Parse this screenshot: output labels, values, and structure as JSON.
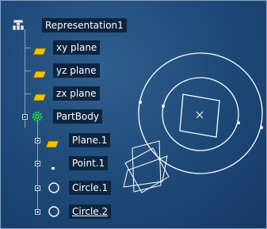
{
  "tree": {
    "root": {
      "label": "Representation1",
      "icon": "representation-icon"
    },
    "items": [
      {
        "label": "xy plane",
        "icon": "plane-icon",
        "expandable": false,
        "underline": false
      },
      {
        "label": "yz plane",
        "icon": "plane-icon",
        "expandable": false,
        "underline": false
      },
      {
        "label": "zx plane",
        "icon": "plane-icon",
        "expandable": false,
        "underline": false
      },
      {
        "label": "PartBody",
        "icon": "gear-icon",
        "expandable": true,
        "expander": "minus",
        "underline": false
      },
      {
        "label": "Plane.1",
        "icon": "plane-icon",
        "expandable": true,
        "expander": "plus",
        "underline": false
      },
      {
        "label": "Point.1",
        "icon": "point-icon",
        "expandable": true,
        "expander": "plus",
        "underline": false
      },
      {
        "label": "Circle.1",
        "icon": "circle-icon",
        "expandable": true,
        "expander": "plus",
        "underline": false
      },
      {
        "label": "Circle.2",
        "icon": "circle-icon",
        "expandable": true,
        "expander": "plus",
        "underline": true
      }
    ]
  },
  "colors": {
    "background": "#1d4877",
    "label_background": "#0c2440",
    "plane_icon": "#f2c200",
    "gear_icon": "#29d64a",
    "geometry": "#ffffff"
  }
}
